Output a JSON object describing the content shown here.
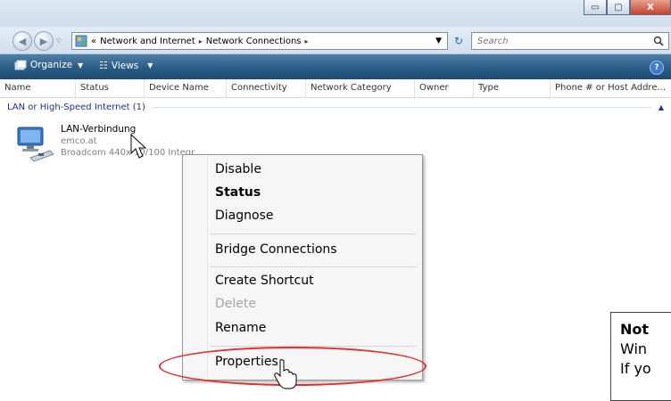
{
  "window": {
    "caption_buttons": {
      "minimize": "▭",
      "maximize": "▢",
      "close": "X"
    }
  },
  "address": {
    "prefix": "«",
    "crumbs": [
      "Network and Internet",
      "Network Connections"
    ],
    "separator": "▸"
  },
  "search": {
    "placeholder": "Search"
  },
  "toolbar": {
    "organize_label": "Organize",
    "views_label": "Views"
  },
  "columns": [
    "Name",
    "Status",
    "Device Name",
    "Connectivity",
    "Network Category",
    "Owner",
    "Type",
    "Phone # or Host Addre..."
  ],
  "group": {
    "label": "LAN or High-Speed Internet (1)"
  },
  "connection": {
    "name": "LAN-Verbindung",
    "domain": "emco.at",
    "device": "Broadcom 440x 10/100 Integr..."
  },
  "context_menu": {
    "items": [
      {
        "label": "Disable",
        "style": "normal"
      },
      {
        "label": "Status",
        "style": "bold"
      },
      {
        "label": "Diagnose",
        "style": "normal"
      },
      {
        "label": "Bridge Connections",
        "style": "normal"
      },
      {
        "label": "Create Shortcut",
        "style": "normal"
      },
      {
        "label": "Delete",
        "style": "disabled"
      },
      {
        "label": "Rename",
        "style": "normal"
      },
      {
        "label": "Properties",
        "style": "normal"
      }
    ]
  },
  "note": {
    "title": "Not",
    "line1": "Win",
    "line2": "If yo"
  },
  "colors": {
    "toolbar": "#2a5c86",
    "group_text": "#1e3287",
    "highlight_oval": "#e03030"
  }
}
